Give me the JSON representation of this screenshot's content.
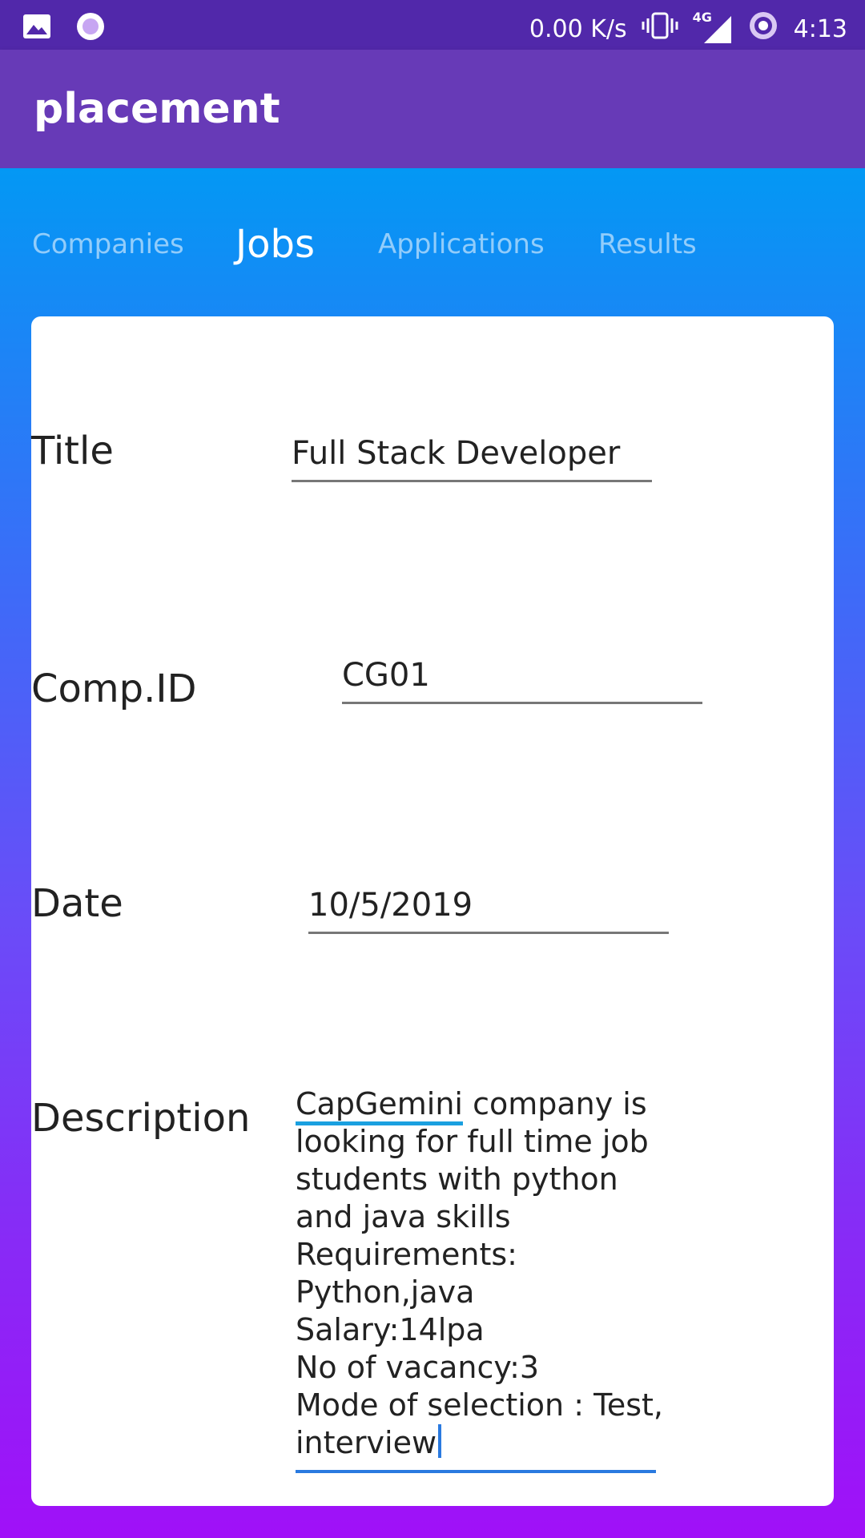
{
  "status_bar": {
    "net_speed": "0.00 K/s",
    "network": "4G",
    "time": "4:13",
    "icons": [
      "image-icon",
      "record-icon",
      "vibrate-icon",
      "signal-icon",
      "sync-icon"
    ]
  },
  "app_bar": {
    "title": "placement"
  },
  "tabs": [
    {
      "label": "Companies",
      "active": false
    },
    {
      "label": "Jobs",
      "active": true
    },
    {
      "label": "Applications",
      "active": false
    },
    {
      "label": "Results",
      "active": false
    }
  ],
  "form": {
    "title_label": "Title",
    "title_value": "Full Stack Developer",
    "compid_label": "Comp.ID",
    "compid_value": "CG01",
    "date_label": "Date",
    "date_value": "10/5/2019",
    "description_label": "Description",
    "description_misspelled_word": "CapGemini",
    "description_lines": [
      " company is",
      "looking for full time job",
      "students with python",
      "and java skills",
      "Requirements:",
      "Python,java",
      "Salary:14lpa",
      "No of vacancy:3",
      "Mode of selection : Test,",
      "interview"
    ]
  },
  "colors": {
    "status_bar": "#5128aa",
    "app_bar": "#673ab7",
    "gradient_top": "#0398f4",
    "gradient_bottom": "#a010f8",
    "accent": "#2a7ae0"
  }
}
